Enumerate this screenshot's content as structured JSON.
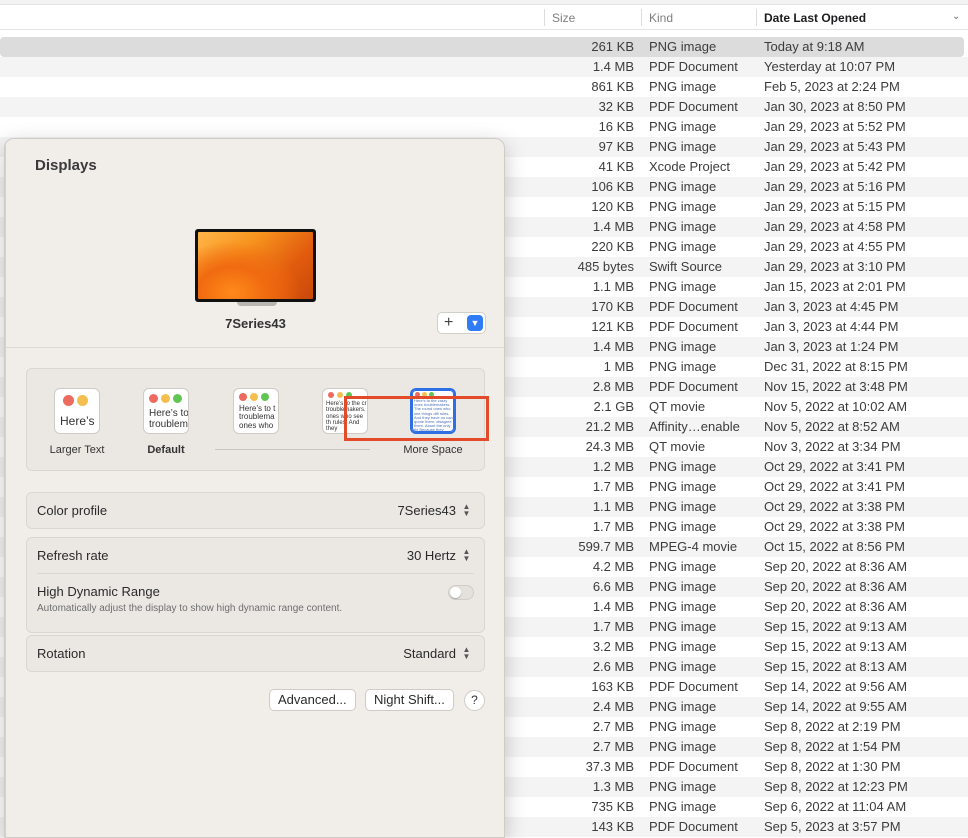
{
  "finder": {
    "columns": {
      "size": "Size",
      "kind": "Kind",
      "date": "Date Last Opened"
    },
    "rows": [
      {
        "size": "261 KB",
        "kind": "PNG image",
        "date": "Today at 9:18 AM"
      },
      {
        "size": "1.4 MB",
        "kind": "PDF Document",
        "date": "Yesterday at 10:07 PM"
      },
      {
        "size": "861 KB",
        "kind": "PNG image",
        "date": "Feb 5, 2023 at 2:24 PM"
      },
      {
        "size": "32 KB",
        "kind": "PDF Document",
        "date": "Jan 30, 2023 at 8:50 PM"
      },
      {
        "size": "16 KB",
        "kind": "PNG image",
        "date": "Jan 29, 2023 at 5:52 PM"
      },
      {
        "size": "97 KB",
        "kind": "PNG image",
        "date": "Jan 29, 2023 at 5:43 PM"
      },
      {
        "size": "41 KB",
        "kind": "Xcode Project",
        "date": "Jan 29, 2023 at 5:42 PM"
      },
      {
        "size": "106 KB",
        "kind": "PNG image",
        "date": "Jan 29, 2023 at 5:16 PM"
      },
      {
        "size": "120 KB",
        "kind": "PNG image",
        "date": "Jan 29, 2023 at 5:15 PM"
      },
      {
        "size": "1.4 MB",
        "kind": "PNG image",
        "date": "Jan 29, 2023 at 4:58 PM"
      },
      {
        "size": "220 KB",
        "kind": "PNG image",
        "date": "Jan 29, 2023 at 4:55 PM"
      },
      {
        "size": "485 bytes",
        "kind": "Swift Source",
        "date": "Jan 29, 2023 at 3:10 PM"
      },
      {
        "size": "1.1 MB",
        "kind": "PNG image",
        "date": "Jan 15, 2023 at 2:01 PM"
      },
      {
        "size": "170 KB",
        "kind": "PDF Document",
        "date": "Jan 3, 2023 at 4:45 PM"
      },
      {
        "size": "121 KB",
        "kind": "PDF Document",
        "date": "Jan 3, 2023 at 4:44 PM"
      },
      {
        "size": "1.4 MB",
        "kind": "PNG image",
        "date": "Jan 3, 2023 at 1:24 PM"
      },
      {
        "size": "1 MB",
        "kind": "PNG image",
        "date": "Dec 31, 2022 at 8:15 PM"
      },
      {
        "size": "2.8 MB",
        "kind": "PDF Document",
        "date": "Nov 15, 2022 at 3:48 PM"
      },
      {
        "size": "2.1 GB",
        "kind": "QT movie",
        "date": "Nov 5, 2022 at 10:02 AM"
      },
      {
        "size": "21.2 MB",
        "kind": "Affinity…enable",
        "date": "Nov 5, 2022 at 8:52 AM"
      },
      {
        "size": "24.3 MB",
        "kind": "QT movie",
        "date": "Nov 3, 2022 at 3:34 PM"
      },
      {
        "size": "1.2 MB",
        "kind": "PNG image",
        "date": "Oct 29, 2022 at 3:41 PM"
      },
      {
        "size": "1.7 MB",
        "kind": "PNG image",
        "date": "Oct 29, 2022 at 3:41 PM"
      },
      {
        "size": "1.1 MB",
        "kind": "PNG image",
        "date": "Oct 29, 2022 at 3:38 PM"
      },
      {
        "size": "1.7 MB",
        "kind": "PNG image",
        "date": "Oct 29, 2022 at 3:38 PM"
      },
      {
        "size": "599.7 MB",
        "kind": "MPEG-4 movie",
        "date": "Oct 15, 2022 at 8:56 PM"
      },
      {
        "size": "4.2 MB",
        "kind": "PNG image",
        "date": "Sep 20, 2022 at 8:36 AM"
      },
      {
        "size": "6.6 MB",
        "kind": "PNG image",
        "date": "Sep 20, 2022 at 8:36 AM"
      },
      {
        "size": "1.4 MB",
        "kind": "PNG image",
        "date": "Sep 20, 2022 at 8:36 AM"
      },
      {
        "size": "1.7 MB",
        "kind": "PNG image",
        "date": "Sep 15, 2022 at 9:13 AM"
      },
      {
        "size": "3.2 MB",
        "kind": "PNG image",
        "date": "Sep 15, 2022 at 9:13 AM"
      },
      {
        "size": "2.6 MB",
        "kind": "PNG image",
        "date": "Sep 15, 2022 at 8:13 AM"
      },
      {
        "size": "163 KB",
        "kind": "PDF Document",
        "date": "Sep 14, 2022 at 9:56 AM"
      },
      {
        "size": "2.4 MB",
        "kind": "PNG image",
        "date": "Sep 14, 2022 at 9:55 AM"
      },
      {
        "size": "2.7 MB",
        "kind": "PNG image",
        "date": "Sep 8, 2022 at 2:19 PM"
      },
      {
        "size": "2.7 MB",
        "kind": "PNG image",
        "date": "Sep 8, 2022 at 1:54 PM"
      },
      {
        "size": "37.3 MB",
        "kind": "PDF Document",
        "date": "Sep 8, 2022 at 1:30 PM"
      },
      {
        "size": "1.3 MB",
        "kind": "PNG image",
        "date": "Sep 8, 2022 at 12:23 PM"
      },
      {
        "size": "735 KB",
        "kind": "PNG image",
        "date": "Sep 6, 2022 at 11:04 AM"
      },
      {
        "size": "143 KB",
        "kind": "PDF Document",
        "date": "Sep 5, 2023 at 3:57 PM"
      }
    ]
  },
  "displays": {
    "title": "Displays",
    "monitor_name": "7Series43",
    "add_button_label": "+",
    "scaling": {
      "options": [
        {
          "label": "Larger Text",
          "preview": "Here’s"
        },
        {
          "label": "Default",
          "preview": "Here’s to troublem"
        },
        {
          "label": "",
          "preview": "Here’s to t troublema ones who"
        },
        {
          "label": "",
          "preview": "Here’s to the cr troublemakers. ones who see th rules. And they"
        },
        {
          "label": "More Space",
          "preview": "Here’s to the crazy ones troublemakers. The round ones who see things diff rules. And they have no can quote them, disagree them. About the only thi Because they change th"
        }
      ],
      "selected_index": 4
    },
    "color_profile": {
      "label": "Color profile",
      "value": "7Series43"
    },
    "refresh_rate": {
      "label": "Refresh rate",
      "value": "30 Hertz"
    },
    "hdr": {
      "label": "High Dynamic Range",
      "description": "Automatically adjust the display to show high dynamic range content.",
      "enabled": false
    },
    "rotation": {
      "label": "Rotation",
      "value": "Standard"
    },
    "buttons": {
      "advanced": "Advanced...",
      "night_shift": "Night Shift...",
      "help": "?"
    },
    "colors": {
      "accent": "#2f7cf6",
      "highlight": "#e24a2a"
    }
  }
}
